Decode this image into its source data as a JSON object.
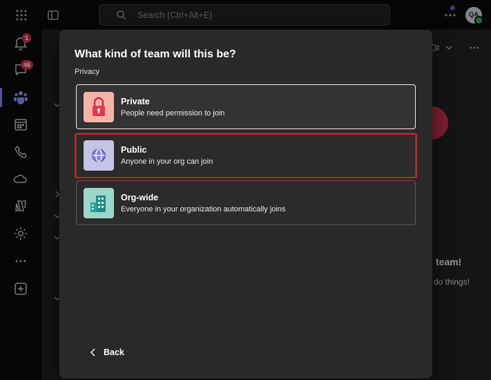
{
  "topbar": {
    "search_placeholder": "Search (Ctrl+Alt+E)",
    "avatar_initials": "QA"
  },
  "rail": {
    "activity_badge": "1",
    "chat_badge": "46"
  },
  "background": {
    "heading_fragment": "team!",
    "text_fragment": "do things!"
  },
  "dialog": {
    "title": "What kind of team will this be?",
    "subtitle": "Privacy",
    "options": [
      {
        "label": "Private",
        "description": "People need permission to join",
        "icon": "lock-icon",
        "tile_color": "#f7b3a8"
      },
      {
        "label": "Public",
        "description": "Anyone in your org can join",
        "icon": "globe-icon",
        "tile_color": "#c5c3e6"
      },
      {
        "label": "Org-wide",
        "description": "Everyone in your organization automatically joins",
        "icon": "building-icon",
        "tile_color": "#9fd6cc"
      }
    ],
    "back_label": "Back"
  },
  "colors": {
    "accent": "#7f85f5",
    "highlight": "#d11c2a",
    "badge": "#c4314b"
  }
}
